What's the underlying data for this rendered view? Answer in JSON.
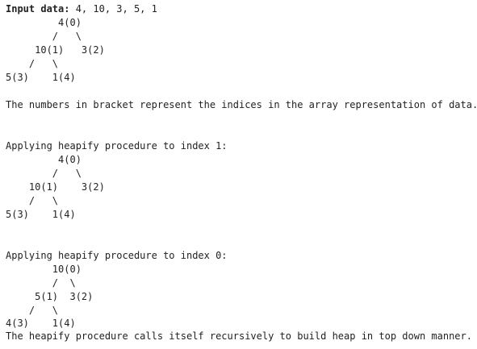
{
  "intro": {
    "label": "Input data:",
    "values": " 4, 10, 3, 5, 1"
  },
  "tree1": [
    "         4(0)",
    "        /   \\",
    "     10(1)   3(2)",
    "    /   \\",
    "5(3)    1(4)"
  ],
  "note_indices": "The numbers in bracket represent the indices in the array representation of data.",
  "step1": {
    "heading": "Applying heapify procedure to index 1:",
    "tree": [
      "         4(0)",
      "        /   \\",
      "    10(1)    3(2)",
      "    /   \\",
      "5(3)    1(4)"
    ]
  },
  "step2": {
    "heading": "Applying heapify procedure to index 0:",
    "tree": [
      "        10(0)",
      "        /  \\",
      "     5(1)  3(2)",
      "    /   \\",
      "4(3)    1(4)"
    ]
  },
  "note_recursive": "The heapify procedure calls itself recursively to build heap in top down manner."
}
